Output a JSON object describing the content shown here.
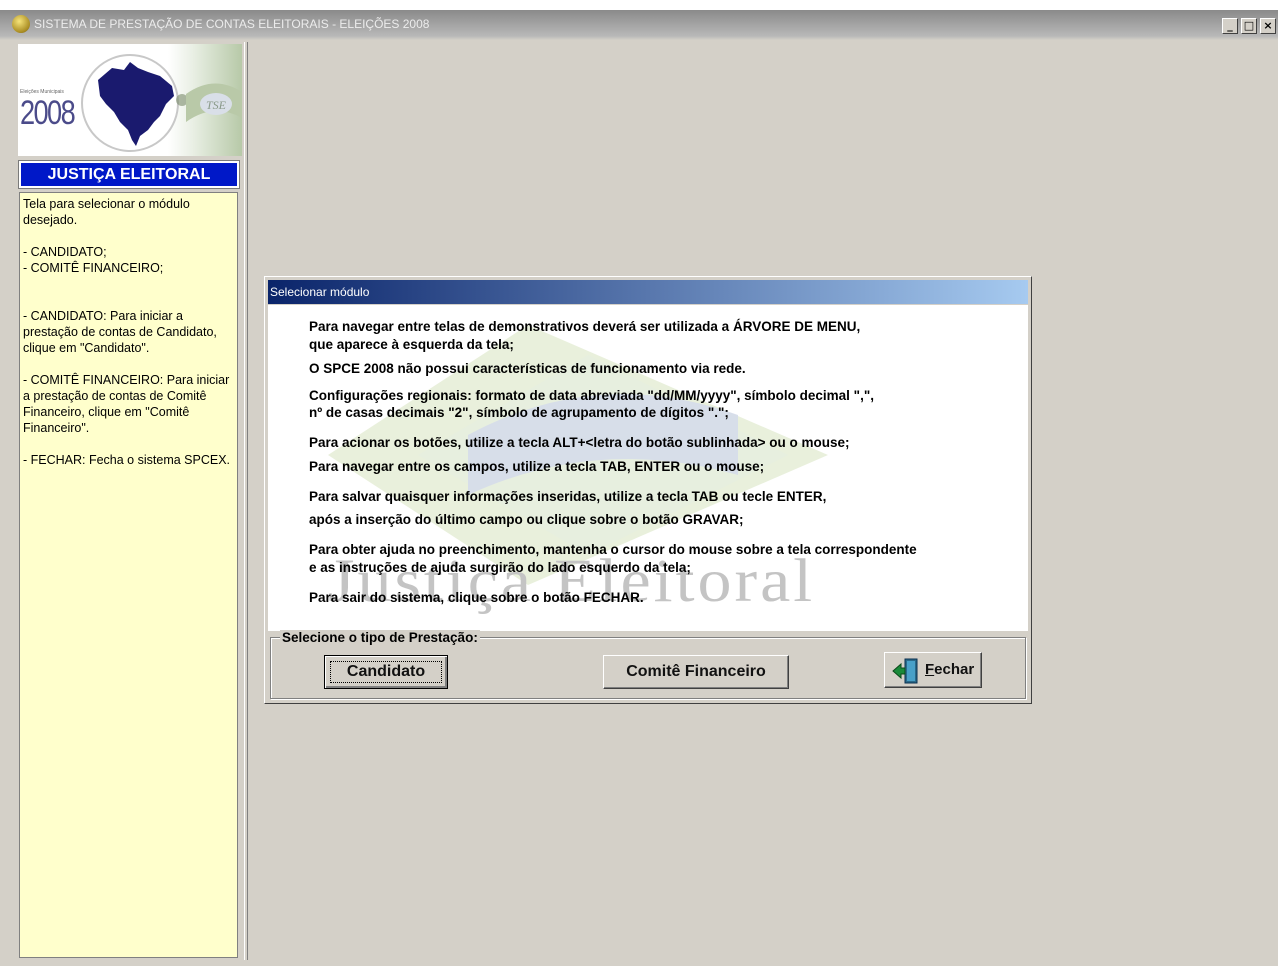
{
  "window": {
    "title": "SISTEMA DE PRESTAÇÃO DE CONTAS ELEITORAIS - ELEIÇÕES 2008",
    "minimize_label": "_",
    "maximize_label": "□",
    "close_label": "×"
  },
  "sidebar": {
    "logo_caption": "Eleições Municipais",
    "logo_year": "2008",
    "banner": "JUSTIÇA ELEITORAL",
    "help": {
      "intro": "Tela para selecionar o módulo desejado.",
      "list_candidato": "- CANDIDATO;",
      "list_comite": "- COMITÊ FINANCEIRO;",
      "candidato_help": "- CANDIDATO: Para iniciar a prestação de contas de Candidato, clique em \"Candidato\".",
      "comite_help": "- COMITÊ FINANCEIRO: Para iniciar a prestação de contas de Comitê Financeiro, clique em \"Comitê Financeiro\".",
      "fechar_help": "- FECHAR: Fecha o sistema SPCEX."
    }
  },
  "dialog": {
    "title": "Selecionar módulo",
    "watermark": "Justiça Eleitoral",
    "lines": [
      "Para navegar entre telas de demonstrativos deverá ser utilizada a ÁRVORE DE MENU,",
      "que aparece à esquerda da tela;",
      "O SPCE 2008 não possui características de funcionamento via rede.",
      "Configurações regionais: formato de data abreviada \"dd/MM/yyyy\", símbolo decimal \",\",",
      "nº de casas decimais \"2\",  símbolo de agrupamento de dígitos \".\";",
      "Para acionar os botões, utilize a tecla ALT+<letra do botão sublinhada> ou o mouse;",
      "Para navegar entre os campos, utilize a tecla TAB, ENTER ou o mouse;",
      "Para salvar quaisquer informações inseridas, utilize a tecla TAB ou tecle ENTER,",
      "após a inserção do último campo ou clique sobre o botão GRAVAR;",
      "Para obter ajuda no preenchimento,  mantenha o cursor do mouse sobre a tela correspondente",
      "e as instruções de ajuda surgirão do lado esquerdo da tela;",
      "Para sair do sistema, clique sobre o botão FECHAR."
    ],
    "group_label": "Selecione o tipo de Prestação:",
    "buttons": {
      "candidato": "Candidato",
      "comite": "Comitê Financeiro",
      "fechar_accel": "F",
      "fechar_rest": "echar"
    }
  },
  "colors": {
    "banner_blue": "#0018c8",
    "help_bg": "#ffffcc",
    "dialog_title_start": "#0a246a",
    "dialog_title_end": "#a6caf0",
    "window_bg": "#d4d0c8"
  }
}
